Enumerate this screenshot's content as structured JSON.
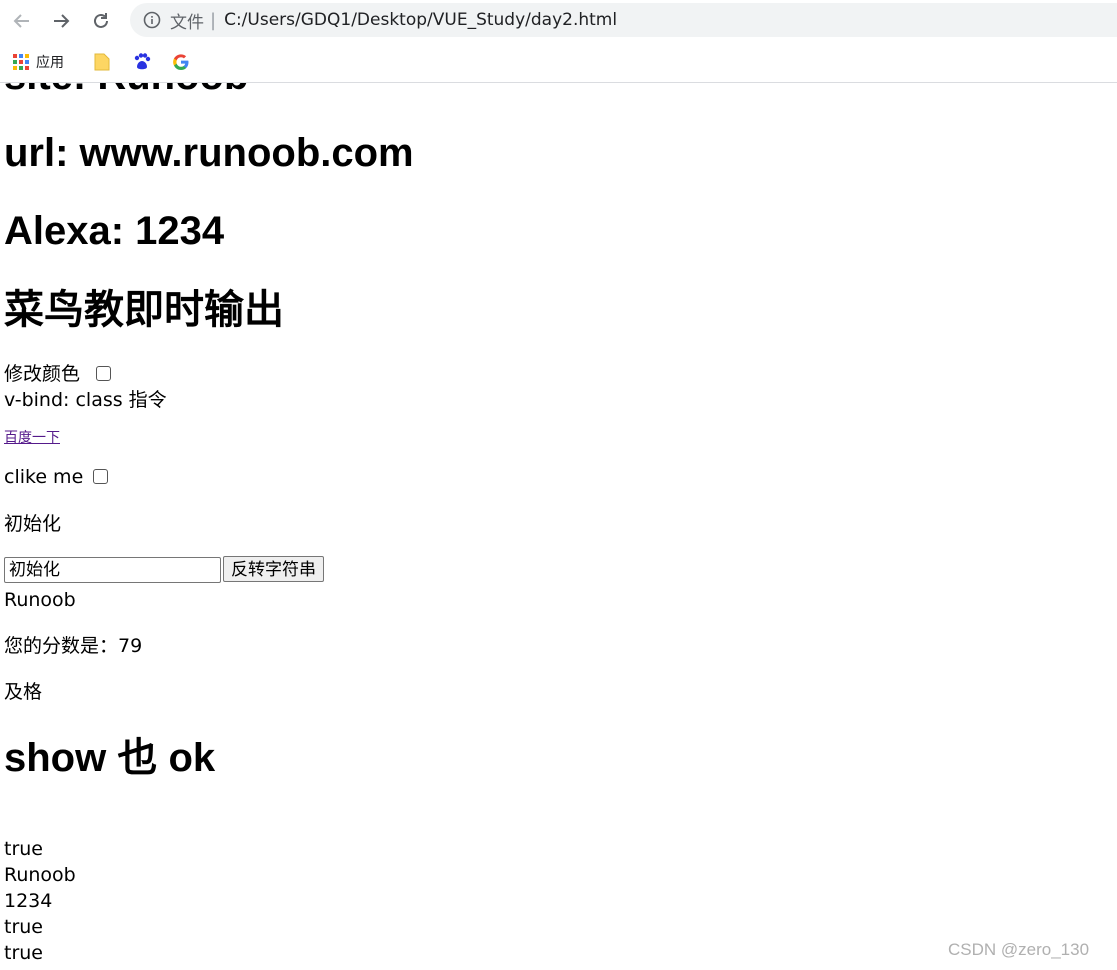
{
  "browser": {
    "scheme_label": "文件",
    "separator": "|",
    "url": "C:/Users/GDQ1/Desktop/VUE_Study/day2.html",
    "bookmarks": {
      "apps_label": "应用"
    }
  },
  "page": {
    "site_line": "site: Runoob",
    "url_line": "url: www.runoob.com",
    "alexa_line": "Alexa: 1234",
    "runoob_heading": "菜鸟教即时输出",
    "color_label": "修改颜色",
    "vbind_text": "v-bind: class 指令",
    "baidu_link": "百度一下",
    "click_label": "clike me",
    "init_text": "初始化",
    "input_value": "初始化",
    "reverse_button": "反转字符串",
    "runoob_text": "Runoob",
    "score_text": "您的分数是：79",
    "pass_text": "及格",
    "show_heading": "show 也 ok",
    "values": [
      "true",
      "Runoob",
      "1234",
      "true",
      "true"
    ]
  },
  "watermark": "CSDN @zero_130",
  "colors": {
    "link": "#551a8b",
    "chrome_bg": "#f1f3f4"
  }
}
